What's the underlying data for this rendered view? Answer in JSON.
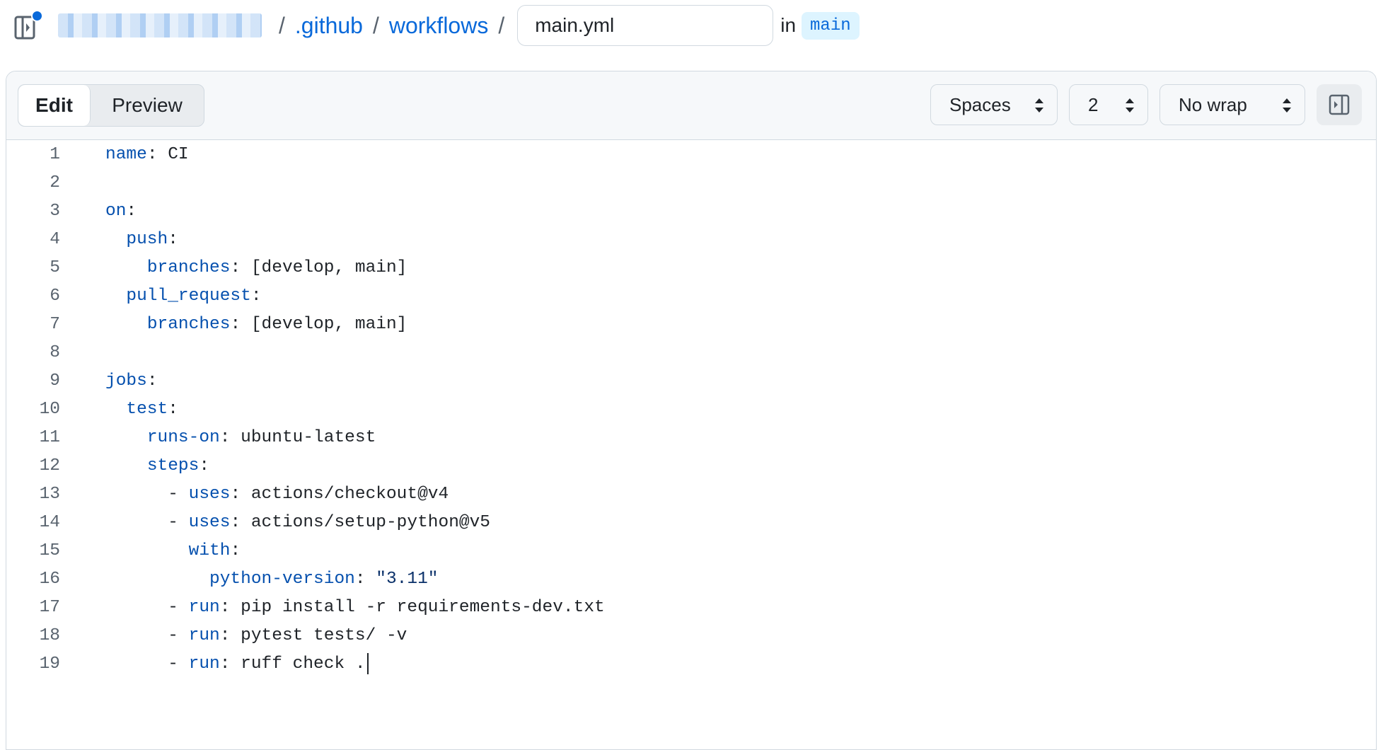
{
  "breadcrumb": {
    "owner_redacted": "",
    "separator": "/",
    "dir1": ".github",
    "dir2": "workflows",
    "filename": "main.yml",
    "in_label": "in",
    "branch": "main"
  },
  "toolbar": {
    "edit_tab": "Edit",
    "preview_tab": "Preview",
    "indent_mode": "Spaces",
    "indent_size": "2",
    "wrap_mode": "No wrap"
  },
  "colors": {
    "accent": "#0969da",
    "key": "#0550ae",
    "string": "#0a3069",
    "border": "#d1d9e0",
    "toolbar_bg": "#f6f8fa"
  },
  "code_lines": [
    {
      "n": "1",
      "segs": [
        {
          "t": "",
          "v": ""
        },
        {
          "t": "k",
          "v": "name"
        },
        {
          "t": "",
          "v": ": CI"
        }
      ]
    },
    {
      "n": "2",
      "segs": []
    },
    {
      "n": "3",
      "segs": [
        {
          "t": "",
          "v": ""
        },
        {
          "t": "k",
          "v": "on"
        },
        {
          "t": "",
          "v": ":"
        }
      ]
    },
    {
      "n": "4",
      "segs": [
        {
          "t": "",
          "v": "  "
        },
        {
          "t": "k",
          "v": "push"
        },
        {
          "t": "",
          "v": ":"
        }
      ]
    },
    {
      "n": "5",
      "segs": [
        {
          "t": "",
          "v": "    "
        },
        {
          "t": "k",
          "v": "branches"
        },
        {
          "t": "",
          "v": ": [develop, main]"
        }
      ]
    },
    {
      "n": "6",
      "segs": [
        {
          "t": "",
          "v": "  "
        },
        {
          "t": "k",
          "v": "pull_request"
        },
        {
          "t": "",
          "v": ":"
        }
      ]
    },
    {
      "n": "7",
      "segs": [
        {
          "t": "",
          "v": "    "
        },
        {
          "t": "k",
          "v": "branches"
        },
        {
          "t": "",
          "v": ": [develop, main]"
        }
      ]
    },
    {
      "n": "8",
      "segs": []
    },
    {
      "n": "9",
      "segs": [
        {
          "t": "",
          "v": ""
        },
        {
          "t": "k",
          "v": "jobs"
        },
        {
          "t": "",
          "v": ":"
        }
      ]
    },
    {
      "n": "10",
      "segs": [
        {
          "t": "",
          "v": "  "
        },
        {
          "t": "k",
          "v": "test"
        },
        {
          "t": "",
          "v": ":"
        }
      ]
    },
    {
      "n": "11",
      "segs": [
        {
          "t": "",
          "v": "    "
        },
        {
          "t": "k",
          "v": "runs-on"
        },
        {
          "t": "",
          "v": ": ubuntu-latest"
        }
      ]
    },
    {
      "n": "12",
      "segs": [
        {
          "t": "",
          "v": "    "
        },
        {
          "t": "k",
          "v": "steps"
        },
        {
          "t": "",
          "v": ":"
        }
      ]
    },
    {
      "n": "13",
      "segs": [
        {
          "t": "",
          "v": "      - "
        },
        {
          "t": "k",
          "v": "uses"
        },
        {
          "t": "",
          "v": ": actions/checkout@v4"
        }
      ]
    },
    {
      "n": "14",
      "segs": [
        {
          "t": "",
          "v": "      - "
        },
        {
          "t": "k",
          "v": "uses"
        },
        {
          "t": "",
          "v": ": actions/setup-python@v5"
        }
      ]
    },
    {
      "n": "15",
      "segs": [
        {
          "t": "",
          "v": "        "
        },
        {
          "t": "k",
          "v": "with"
        },
        {
          "t": "",
          "v": ":"
        }
      ]
    },
    {
      "n": "16",
      "segs": [
        {
          "t": "",
          "v": "          "
        },
        {
          "t": "k",
          "v": "python-version"
        },
        {
          "t": "",
          "v": ": "
        },
        {
          "t": "s",
          "v": "\"3.11\""
        }
      ]
    },
    {
      "n": "17",
      "segs": [
        {
          "t": "",
          "v": "      - "
        },
        {
          "t": "k",
          "v": "run"
        },
        {
          "t": "",
          "v": ": pip install -r requirements-dev.txt"
        }
      ]
    },
    {
      "n": "18",
      "segs": [
        {
          "t": "",
          "v": "      - "
        },
        {
          "t": "k",
          "v": "run"
        },
        {
          "t": "",
          "v": ": pytest tests/ -v"
        }
      ]
    },
    {
      "n": "19",
      "segs": [
        {
          "t": "",
          "v": "      - "
        },
        {
          "t": "k",
          "v": "run"
        },
        {
          "t": "",
          "v": ": ruff check ."
        }
      ],
      "caret": true
    }
  ]
}
